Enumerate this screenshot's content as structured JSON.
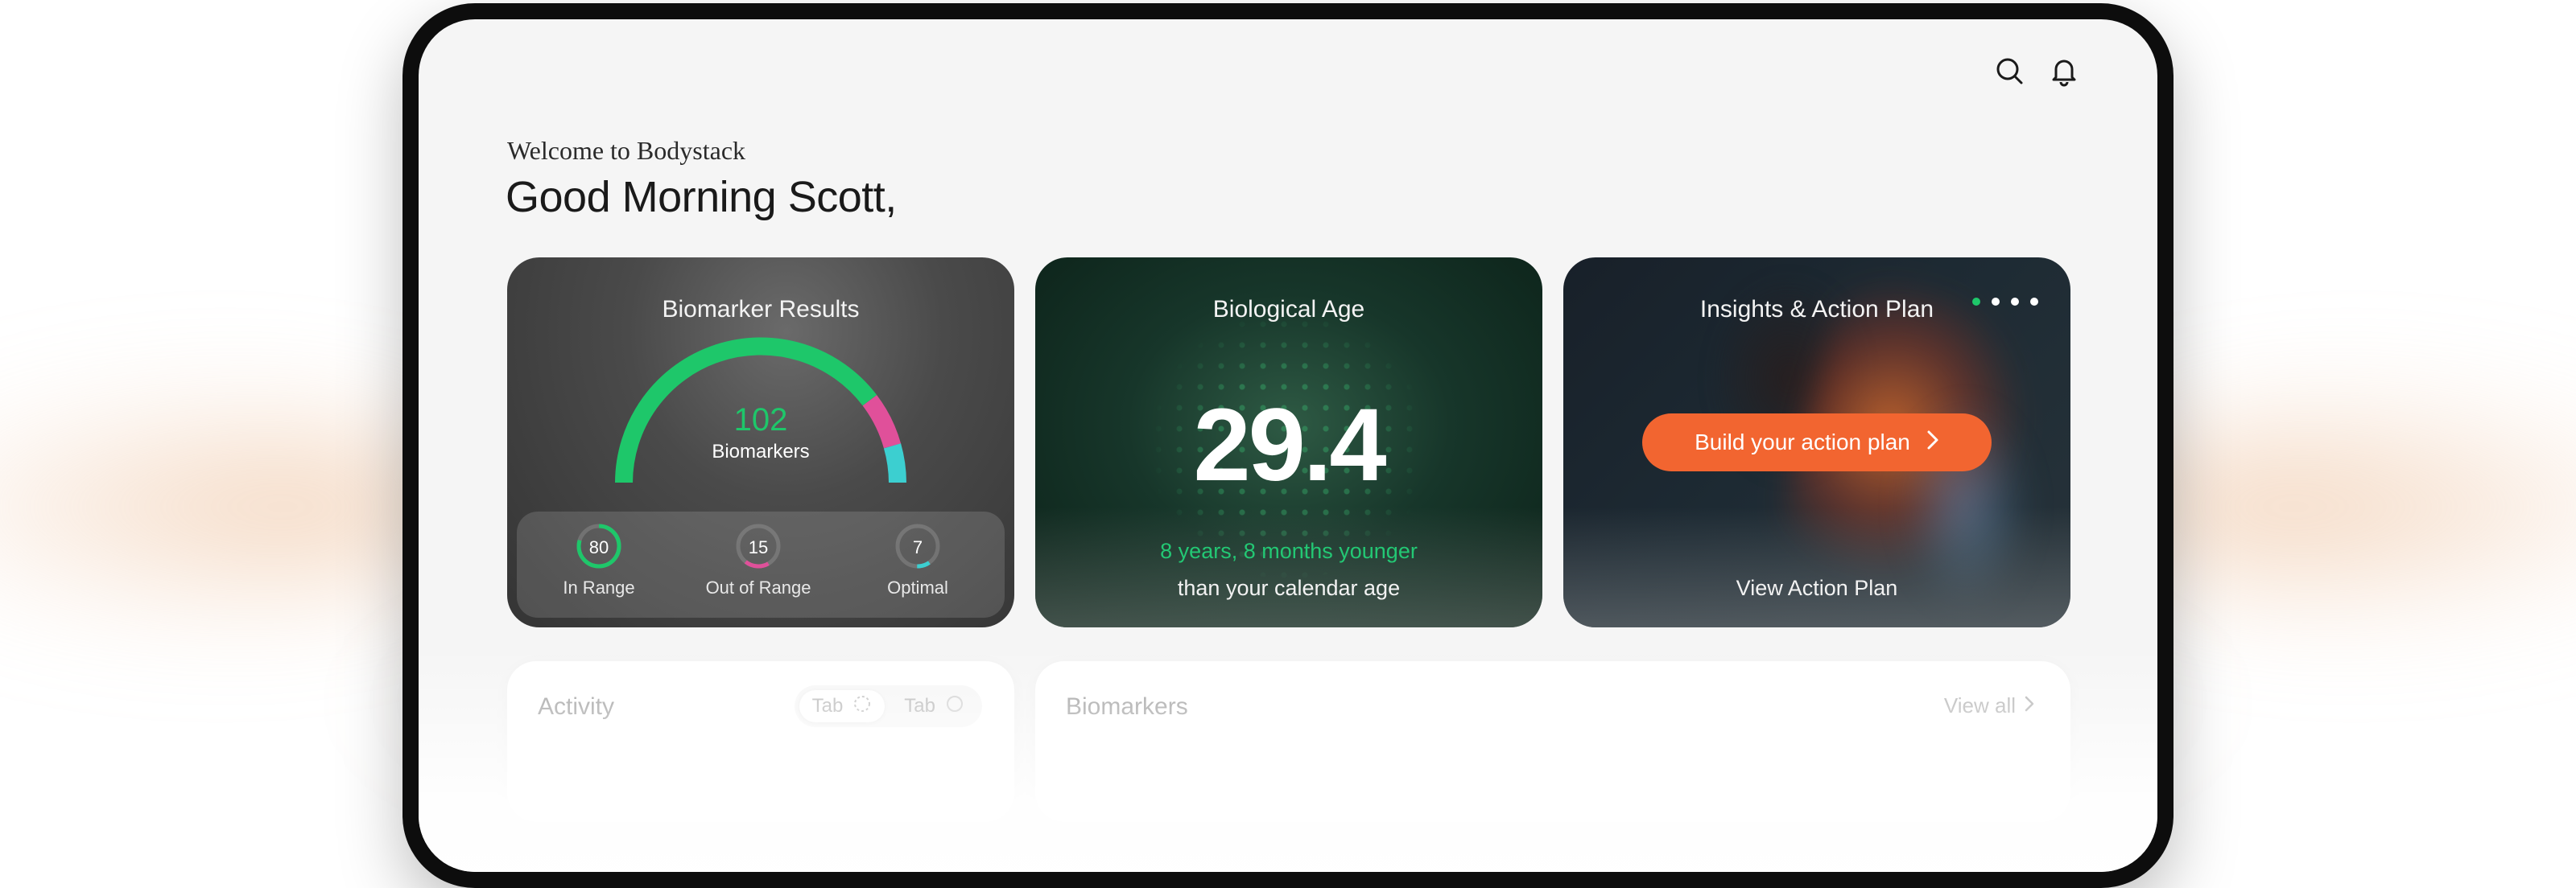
{
  "header": {
    "welcome": "Welcome to Bodystack",
    "greeting": "Good Morning Scott,",
    "icons": [
      "search-icon",
      "bell-icon"
    ]
  },
  "biomarker_card": {
    "title": "Biomarker Results",
    "total": "102",
    "total_label": "Biomarkers",
    "stats": [
      {
        "value": "80",
        "label": "In Range",
        "color": "#1ec76a"
      },
      {
        "value": "15",
        "label": "Out of Range",
        "color": "#e0509a"
      },
      {
        "value": "7",
        "label": "Optimal",
        "color": "#3ccfd0"
      }
    ]
  },
  "age_card": {
    "title": "Biological Age",
    "value": "29.4",
    "difference": "8 years, 8 months younger",
    "subtitle": "than your calendar age"
  },
  "insights_card": {
    "title": "Insights & Action Plan",
    "cta_label": "Build your action plan",
    "link_label": "View Action Plan",
    "pager_count": 4,
    "pager_active": 0
  },
  "activity_panel": {
    "title": "Activity",
    "tabs": [
      "Tab",
      "Tab"
    ]
  },
  "biomarkers_panel": {
    "title": "Biomarkers",
    "view_all": "View all"
  },
  "colors": {
    "accent_green": "#1ec76a",
    "accent_pink": "#e0509a",
    "accent_teal": "#3ccfd0",
    "cta_orange": "#f26530"
  }
}
